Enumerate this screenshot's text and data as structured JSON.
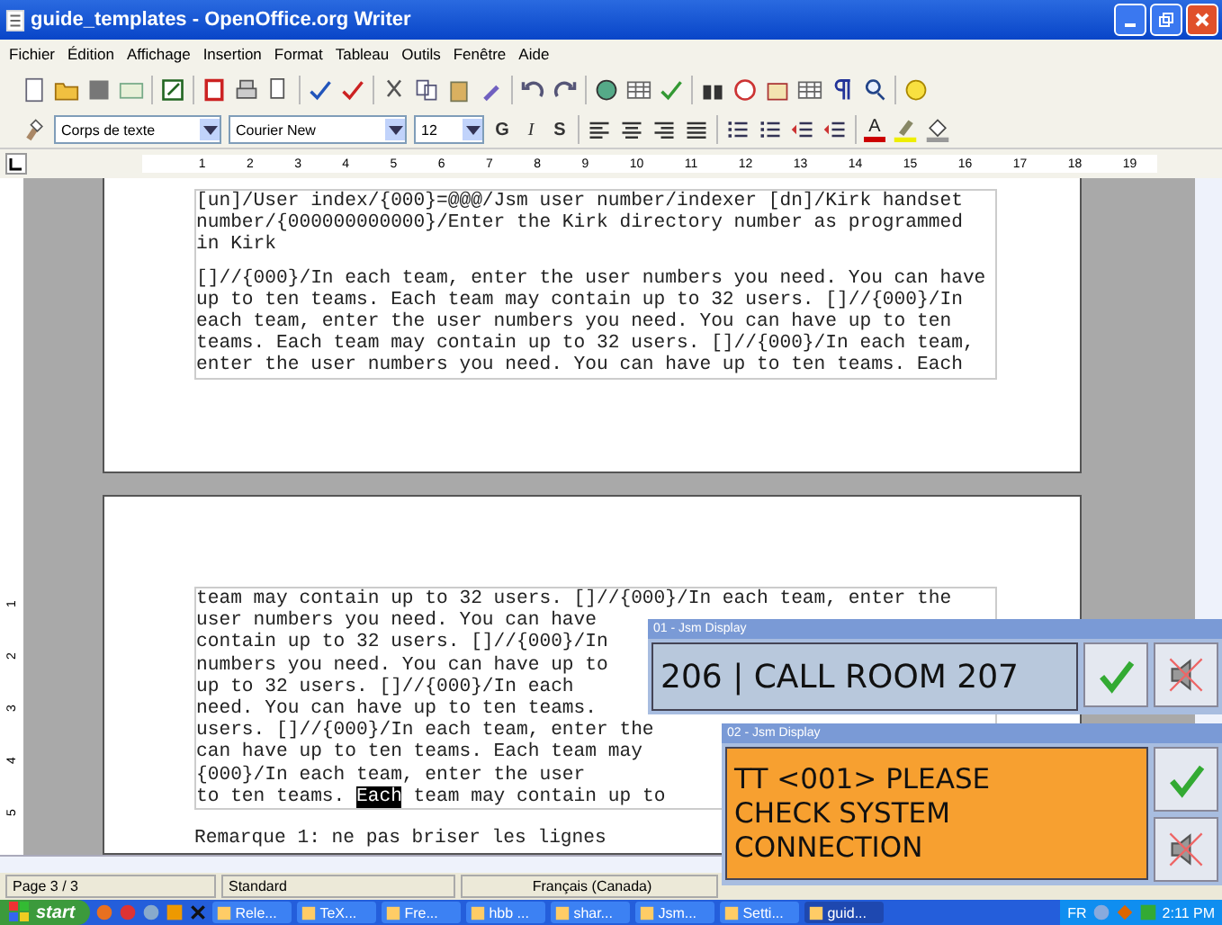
{
  "window": {
    "title": "guide_templates - OpenOffice.org Writer"
  },
  "menu": [
    "Fichier",
    "Édition",
    "Affichage",
    "Insertion",
    "Format",
    "Tableau",
    "Outils",
    "Fenêtre",
    "Aide"
  ],
  "format_toolbar": {
    "style": "Corps de texte",
    "font": "Courier New",
    "size": "12",
    "bold": "G",
    "italic": "I",
    "shadow": "S",
    "font_color": "A"
  },
  "ruler": [
    "1",
    "2",
    "3",
    "4",
    "5",
    "6",
    "7",
    "8",
    "9",
    "10",
    "11",
    "12",
    "13",
    "14",
    "15",
    "16",
    "17",
    "18",
    "19"
  ],
  "vertical_ruler": [
    "1",
    "2",
    "3",
    "4",
    "5"
  ],
  "page_1": {
    "paragraphs": [
      [
        "[un]/User index/{000}=@@@/Jsm user number/indexer [dn]/Kirk handset",
        "number/{000000000000}/Enter the Kirk directory number as programmed",
        "in Kirk"
      ],
      [
        "[]//{000}/In each team, enter the user numbers you need. You can have",
        "up to ten teams. Each team may contain up to 32 users. []//{000}/In",
        "each team, enter the user numbers you need. You can have up to ten",
        "teams. Each team may contain up to 32 users. []//{000}/In each team,",
        "enter the user numbers you need. You can have up to ten teams. Each"
      ]
    ]
  },
  "page_2": {
    "lines": [
      {
        "text": "team may contain up to 32 users. []//{000}/In each team, enter the"
      },
      {
        "text": "user numbers you need. You can have"
      },
      {
        "text": "contain up to 32 users. []//{000}/In"
      },
      {
        "text": "numbers you need. You can have up to"
      },
      {
        "text": "up to 32 users. []//{000}/In each"
      },
      {
        "text": "need. You can have up to ten teams."
      },
      {
        "text": "users. []//{000}/In each team, enter the"
      },
      {
        "text": "can have up to ten teams. Each team may"
      },
      {
        "text": "{000}/In each team, enter the user"
      },
      {
        "before": "to ten teams. ",
        "selected": "Each",
        "after": " team may contain up to"
      }
    ],
    "note": "Remarque 1: ne pas briser les lignes"
  },
  "status_bar": [
    "Page 3 / 3",
    "Standard",
    "Français (Canada)"
  ],
  "jsm_displays": [
    {
      "title": "01 - Jsm Display",
      "text": "206 | CALL ROOM 207",
      "color": "#b8c8dc"
    },
    {
      "title": "02 - Jsm Display",
      "text": "TT <001> PLEASE CHECK SYSTEM CONNECTION",
      "color": "#f7a030"
    }
  ],
  "taskbar": {
    "start": "start",
    "tasks": [
      {
        "label": "Rele...",
        "selected": false
      },
      {
        "label": "TeX...",
        "selected": false
      },
      {
        "label": "Fre...",
        "selected": false
      },
      {
        "label": "hbb ...",
        "selected": false
      },
      {
        "label": "shar...",
        "selected": false
      },
      {
        "label": "Jsm...",
        "selected": false
      },
      {
        "label": "Setti...",
        "selected": false
      },
      {
        "label": "guid...",
        "selected": true
      }
    ],
    "language": "FR",
    "clock": "2:11 PM"
  }
}
